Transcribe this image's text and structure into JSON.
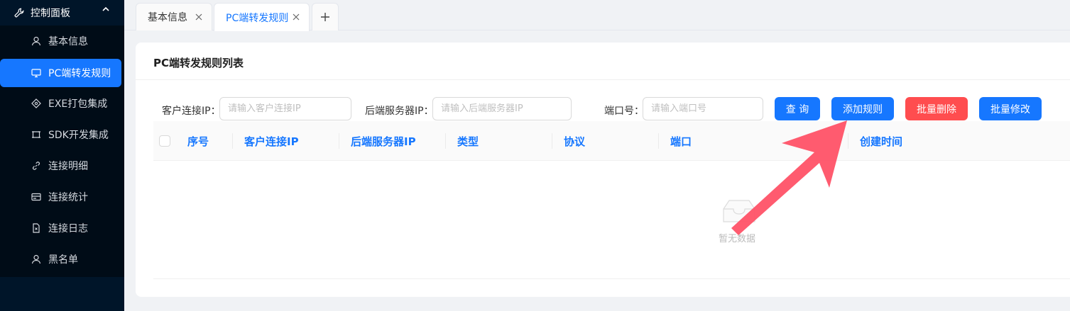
{
  "sidebar": {
    "header_label": "控制面板",
    "items": [
      {
        "label": "基本信息",
        "icon": "user-icon"
      },
      {
        "label": "PC端转发规则",
        "icon": "monitor-icon",
        "active": true
      },
      {
        "label": "EXE打包集成",
        "icon": "diamond-icon"
      },
      {
        "label": "SDK开发集成",
        "icon": "frame-icon"
      },
      {
        "label": "连接明细",
        "icon": "link-icon"
      },
      {
        "label": "连接统计",
        "icon": "card-icon"
      },
      {
        "label": "连接日志",
        "icon": "file-icon"
      },
      {
        "label": "黑名单",
        "icon": "user-icon"
      }
    ]
  },
  "tabs": [
    {
      "label": "基本信息"
    },
    {
      "label": "PC端转发规则",
      "active": true
    }
  ],
  "card": {
    "title": "PC端转发规则列表"
  },
  "filters": {
    "client_ip_label": "客户连接IP：",
    "client_ip_placeholder": "请输入客户连接IP",
    "server_ip_label": "后端服务器IP：",
    "server_ip_placeholder": "请输入后端服务器IP",
    "port_label": "端口号：",
    "port_placeholder": "请输入端口号"
  },
  "buttons": {
    "query": "查 询",
    "add_rule": "添加规则",
    "batch_delete": "批量删除",
    "batch_edit": "批量修改"
  },
  "table": {
    "columns": [
      "序号",
      "客户连接IP",
      "后端服务器IP",
      "类型",
      "协议",
      "端口",
      "创建时间"
    ],
    "empty_text": "暂无数据"
  },
  "colors": {
    "sidebar_bg": "#001529",
    "primary": "#1677ff",
    "danger": "#ff4d4f",
    "annotation_arrow": "#ff4d63"
  }
}
